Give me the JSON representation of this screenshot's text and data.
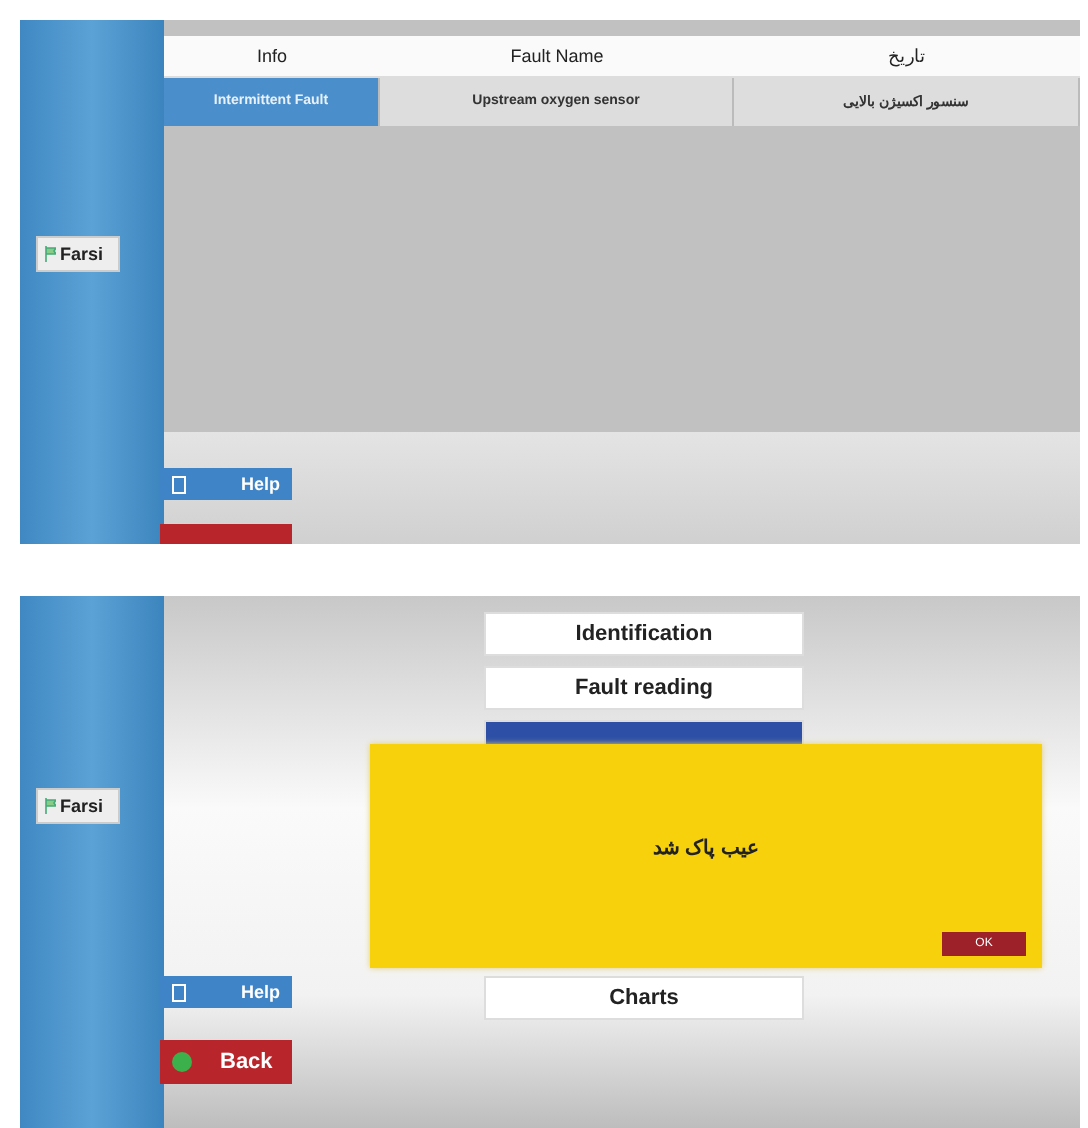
{
  "fault_screen": {
    "language_button": "Farsi",
    "table": {
      "columns": [
        "Info",
        "Fault Name",
        "تاریخ"
      ],
      "rows": [
        {
          "cells": [
            {
              "text": "Intermittent Fault",
              "selected": true
            },
            {
              "text": "Upstream oxygen sensor",
              "selected": false
            },
            {
              "text": "سنسور اکسیژن بالایی",
              "selected": false
            }
          ]
        }
      ]
    },
    "help_button": "Help"
  },
  "menu_screen": {
    "language_button": "Farsi",
    "menu": [
      {
        "label": "Identification",
        "selected": false
      },
      {
        "label": "Fault reading",
        "selected": false
      },
      {
        "selected": true
      },
      {
        "label": "Charts",
        "selected": false
      }
    ],
    "dialog": {
      "message": "عیب پاک شد",
      "button": "OK"
    },
    "help_button": "Help",
    "back_button": "Back"
  }
}
